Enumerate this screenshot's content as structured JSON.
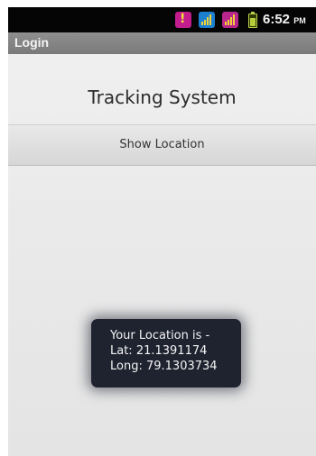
{
  "status_bar": {
    "time": "6:52",
    "time_suffix": "PM",
    "icons": [
      "warning-icon",
      "signal-icon",
      "signal-icon",
      "battery-icon"
    ],
    "colors": {
      "warning": "#c21c8f",
      "signal_primary": "#1c7fd0",
      "signal_secondary": "#b8258c"
    }
  },
  "title_bar": {
    "title": "Login"
  },
  "main": {
    "heading": "Tracking System",
    "show_location_label": "Show Location"
  },
  "toast": {
    "line1": "Your Location is -",
    "line2": "Lat: 21.1391174",
    "line3": "Long: 79.1303734"
  }
}
